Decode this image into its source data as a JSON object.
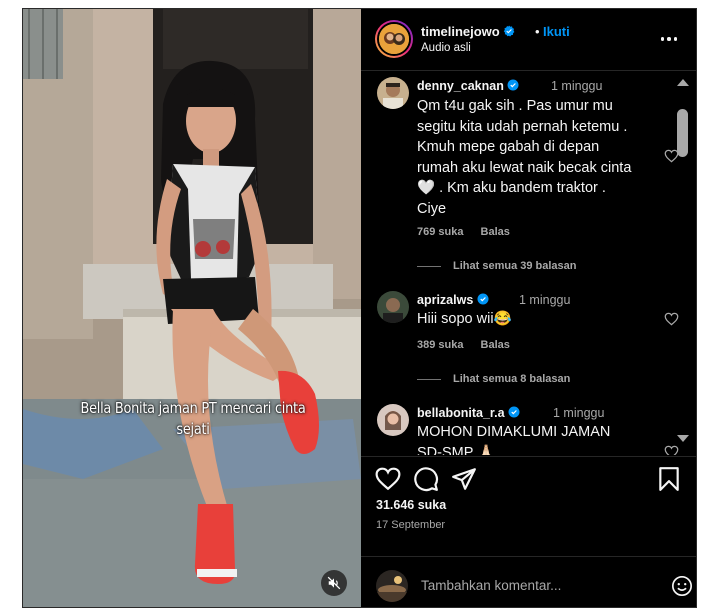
{
  "post": {
    "username": "timelinejowo",
    "dot": "•",
    "follow_label": "Ikuti",
    "audio": "Audio asli",
    "caption_overlay": "Bella Bonita jaman PT mencari cinta sejati",
    "likes": "31.646 suka",
    "date": "17 September"
  },
  "comments": [
    {
      "username": "denny_caknan",
      "time": "1 minggu",
      "text": "Qm t4u gak sih . Pas umur mu segitu kita udah pernah ketemu . Kmuh mepe gabah di depan rumah aku lewat naik becak cinta 🤍 . Km aku bandem traktor . Ciye",
      "likes": "769 suka",
      "reply_label": "Balas",
      "view_replies": "Lihat semua 39 balasan"
    },
    {
      "username": "aprizalws",
      "time": "1 minggu",
      "text": "Hiii sopo wii😂",
      "likes": "389 suka",
      "reply_label": "Balas",
      "view_replies": "Lihat semua 8 balasan"
    },
    {
      "username": "bellabonita_r.a",
      "time": "1 minggu",
      "text": "MOHON DIMAKLUMI JAMAN SD-SMP 🙏🏻"
    }
  ],
  "add_comment": {
    "placeholder": "Tambahkan komentar..."
  },
  "icons": {
    "verified": "verified-badge-icon",
    "more": "more-options-icon",
    "heart": "heart-icon",
    "comment": "comment-icon",
    "share": "share-icon",
    "save": "bookmark-icon",
    "emoji": "emoji-icon",
    "mute": "muted-speaker-icon"
  },
  "colors": {
    "background": "#000000",
    "text": "#f5f5f5",
    "secondary": "#a8a8a8",
    "link": "#0095f6",
    "verified": "#0095f6",
    "shoes": "#e8403a"
  }
}
